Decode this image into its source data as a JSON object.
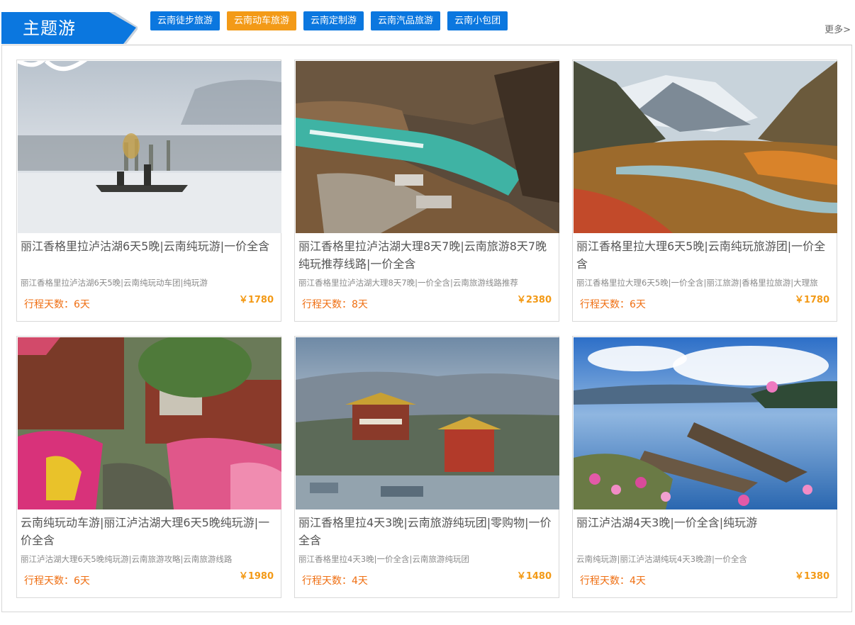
{
  "section": {
    "title": "主题游",
    "more_label": "更多>"
  },
  "tags": [
    {
      "label": "云南徒步旅游",
      "active": false
    },
    {
      "label": "云南动车旅游",
      "active": true
    },
    {
      "label": "云南定制游",
      "active": false
    },
    {
      "label": "云南汽品旅游",
      "active": false
    },
    {
      "label": "云南小包团",
      "active": false
    }
  ],
  "colors": {
    "brand_blue": "#0b77df",
    "active_orange": "#f39a17",
    "days_orange": "#ef6e11"
  },
  "products": [
    {
      "name": "丽江香格里拉泸沽湖6天5晚|云南纯玩游|一价全含",
      "subtitle": "丽江香格里拉泸沽湖6天5晚|云南纯玩动车团|纯玩游",
      "days": "行程天数：6天",
      "price": "￥1780",
      "image": "misty-lake-boat-photo"
    },
    {
      "name": "丽江香格里拉泸沽湖大理8天7晚|云南旅游8天7晚纯玩推荐线路|一价全含",
      "subtitle": "丽江香格里拉泸沽湖大理8天7晚|一价全含|云南旅游线路推荐",
      "days": "行程天数：8天",
      "price": "￥2380",
      "image": "tiger-leaping-gorge-photo"
    },
    {
      "name": "丽江香格里拉大理6天5晚|云南纯玩旅游团|一价全含",
      "subtitle": "丽江香格里拉大理6天5晚|一价全含|丽江旅游|香格里拉旅游|大理旅",
      "days": "行程天数：6天",
      "price": "￥1780",
      "image": "snow-mountain-valley-photo"
    },
    {
      "name": "云南纯玩动车游|丽江泸沽湖大理6天5晚纯玩游|一价全含",
      "subtitle": "丽江泸沽湖大理6天5晚纯玩游|云南旅游攻略|云南旅游线路",
      "days": "行程天数：6天",
      "price": "￥1980",
      "image": "old-town-flowers-photo"
    },
    {
      "name": "丽江香格里拉4天3晚|云南旅游纯玩团|零购物|一价全含",
      "subtitle": "丽江香格里拉4天3晚|一价全含|云南旅游纯玩团",
      "days": "行程天数：4天",
      "price": "￥1480",
      "image": "monastery-town-photo"
    },
    {
      "name": "丽江泸沽湖4天3晚|一价全含|纯玩游",
      "subtitle": "云南纯玩游|丽江泸沽湖纯玩4天3晚游|一价全含",
      "days": "行程天数：4天",
      "price": "￥1380",
      "image": "lake-boats-cosmos-photo"
    }
  ]
}
